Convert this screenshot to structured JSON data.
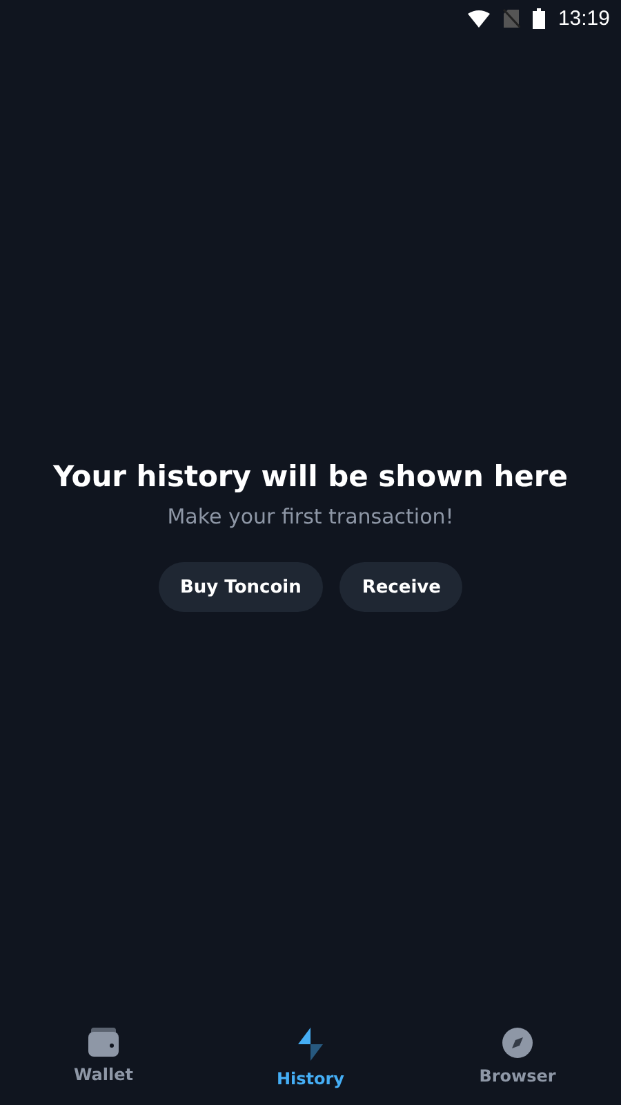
{
  "status_bar": {
    "time": "13:19"
  },
  "empty_state": {
    "title": "Your history will be shown here",
    "subtitle": "Make your first transaction!"
  },
  "buttons": [
    {
      "label": "Buy Toncoin"
    },
    {
      "label": "Receive"
    }
  ],
  "tabs": [
    {
      "label": "Wallet",
      "kind": "wallet",
      "selected": false
    },
    {
      "label": "History",
      "kind": "history",
      "selected": true
    },
    {
      "label": "Browser",
      "kind": "browser",
      "selected": false
    }
  ]
}
